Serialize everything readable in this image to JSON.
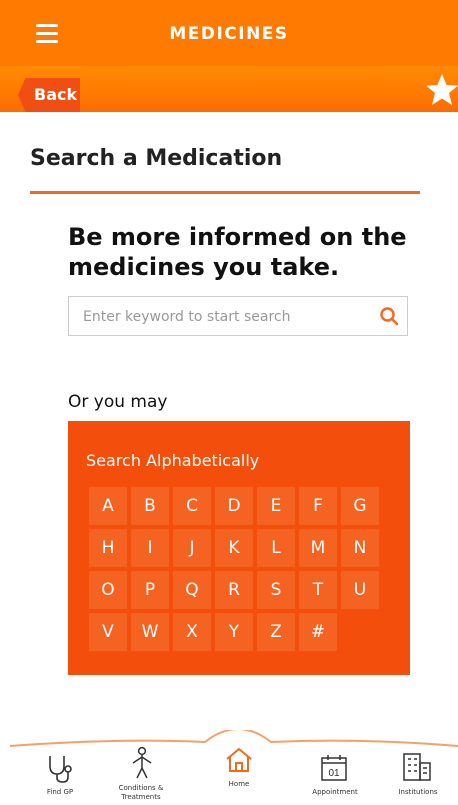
{
  "header": {
    "title": "MEDICINES",
    "back_label": "Back"
  },
  "page": {
    "title": "Search a Medication",
    "headline": "Be more informed on the medicines you take.",
    "search_placeholder": "Enter keyword to start search",
    "or_label": "Or you may"
  },
  "alphabet": {
    "title": "Search Alphabetically",
    "letters": [
      "A",
      "B",
      "C",
      "D",
      "E",
      "F",
      "G",
      "H",
      "I",
      "J",
      "K",
      "L",
      "M",
      "N",
      "O",
      "P",
      "Q",
      "R",
      "S",
      "T",
      "U",
      "V",
      "W",
      "X",
      "Y",
      "Z",
      "#"
    ]
  },
  "bottom_nav": {
    "find_gp": "Find GP",
    "conditions_line1": "Conditions &",
    "conditions_line2": "Treatments",
    "home": "Home",
    "appointment": "Appointment",
    "appointment_date": "01",
    "institutions": "Institutions"
  },
  "colors": {
    "header": "#FF7A00",
    "back": "#F04E12",
    "panel": "#F44E0C",
    "tile": "#F56322",
    "accent": "#F26A20"
  }
}
